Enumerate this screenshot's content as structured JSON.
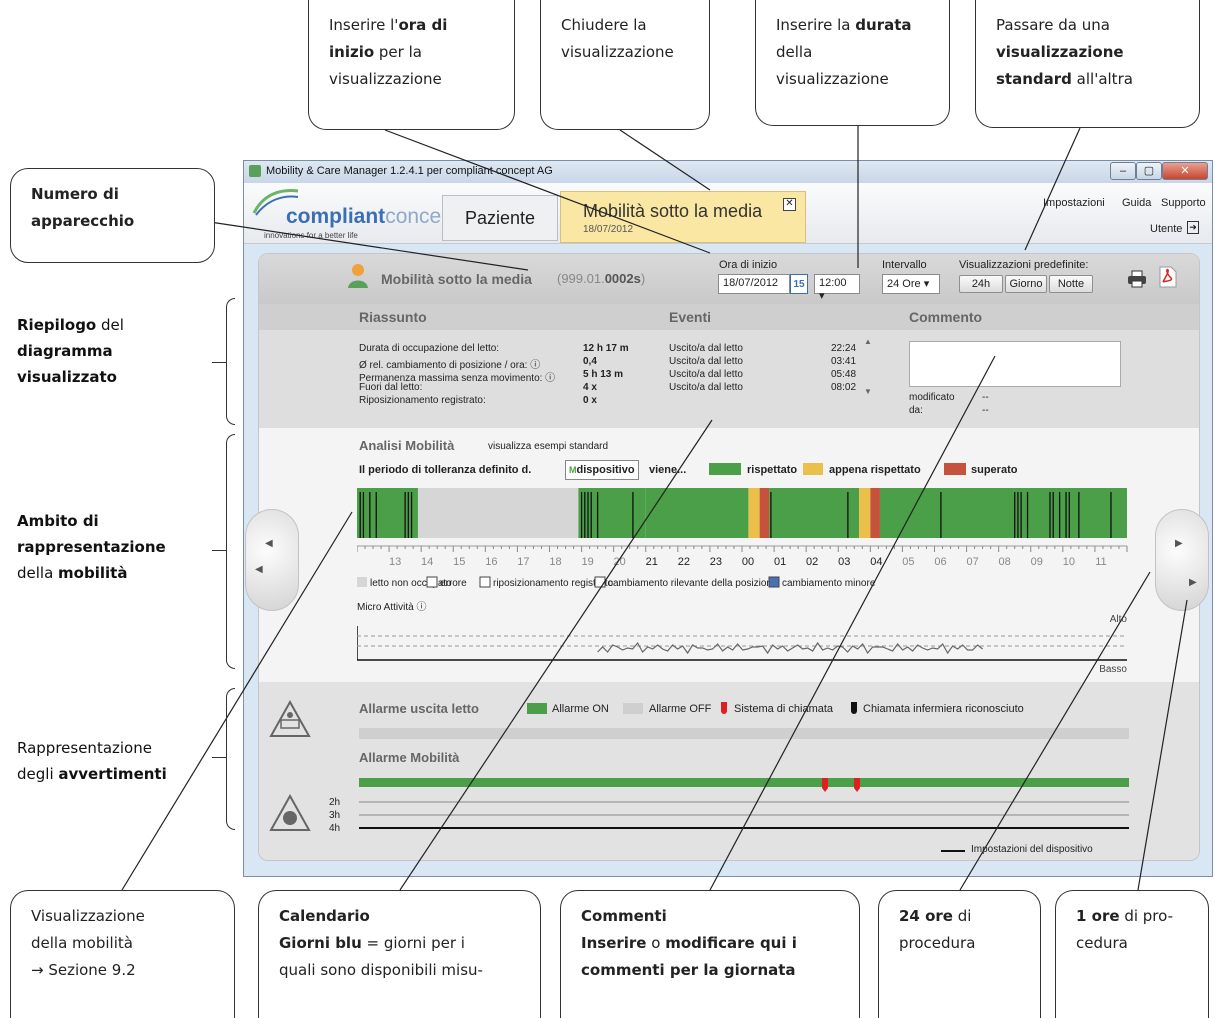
{
  "window": {
    "title": "Mobility & Care Manager 1.2.4.1 per compliant concept AG",
    "btn_min": "–",
    "btn_max": "▢",
    "btn_close": "✕"
  },
  "appbar": {
    "logo_bold": "compliant",
    "logo_light": "concept",
    "tagline": "innovations for a better life",
    "tab_patient": "Paziente",
    "tab_active_title": "Mobilità sotto la media",
    "tab_active_date": "18/07/2012",
    "tab_close": "✕",
    "links": [
      "Impostazioni",
      "Guida",
      "Supporto"
    ],
    "user": "Utente"
  },
  "header": {
    "title": "Mobilità sotto la media",
    "device_prefix": "(999.01.",
    "device_bold": "0002s",
    "device_suffix": ")",
    "start_label": "Ora di inizio",
    "date_value": "18/07/2012",
    "cal_day": "15",
    "time_value": "12:00",
    "interval_label": "Intervallo",
    "interval_value": "24 Ore",
    "predef_label": "Visualizzazioni predefinite:",
    "predef_buttons": [
      "24h",
      "Giorno",
      "Notte"
    ]
  },
  "summary": {
    "heading": "Riassunto",
    "rows": [
      {
        "label": "Durata di occupazione del letto:",
        "value": "12 h 17 m"
      },
      {
        "label": "Ø rel. cambiamento di posizione / ora: ⓘ",
        "value": "0,4"
      },
      {
        "label": "Permanenza massima senza movimento: ⓘ",
        "value": "5 h 13 m"
      },
      {
        "label": "Fuori dal letto:",
        "value": "4 x"
      },
      {
        "label": "Riposizionamento registrato:",
        "value": "0 x"
      }
    ]
  },
  "events": {
    "heading": "Eventi",
    "rows": [
      {
        "label": "Uscito/a dal letto",
        "time": "22:24"
      },
      {
        "label": "Uscito/a dal letto",
        "time": "03:41"
      },
      {
        "label": "Uscito/a dal letto",
        "time": "05:48"
      },
      {
        "label": "Uscito/a dal letto",
        "time": "08:02"
      }
    ]
  },
  "comment": {
    "heading": "Commento",
    "modified_label": "modificato",
    "modified_value": "--",
    "by_label": "da:",
    "by_value": "--"
  },
  "mobility": {
    "title": "Analisi Mobilità",
    "subtitle": "visualizza esempi standard",
    "tolerance_prefix": "Il periodo di tolleranza definito d.",
    "tolerance_button": "dispositivo",
    "tolerance_suffix": "viene...",
    "legend_rispettato": "rispettato",
    "legend_appena": "appena rispettato",
    "legend_superato": "superato",
    "hours": [
      "13",
      "14",
      "15",
      "16",
      "17",
      "18",
      "19",
      "20",
      "21",
      "22",
      "23",
      "00",
      "01",
      "02",
      "03",
      "04",
      "05",
      "06",
      "07",
      "08",
      "09",
      "10",
      "11"
    ],
    "legend2": [
      "letto non occupato",
      "errore",
      "riposizionamento registrato",
      "cambiamento rilevante della posizione",
      "cambiamento minore"
    ],
    "micro_title": "Micro Attività ⓘ",
    "micro_high": "Alto",
    "micro_low": "Basso"
  },
  "alarms": {
    "bed_exit_title": "Allarme uscita letto",
    "legend": [
      "Allarme ON",
      "Allarme OFF",
      "Sistema di chiamata",
      "Chiamata infermiera riconosciuto"
    ],
    "mobility_title": "Allarme Mobilità",
    "levels": [
      "2h",
      "3h",
      "4h"
    ],
    "device_settings": "Impostazioni del dispositivo"
  },
  "colors": {
    "green": "#4a9f48",
    "yellow": "#ebc04a",
    "red": "#c5523a",
    "grey": "#d6d6d6",
    "alarm_red": "#e02020"
  },
  "callouts_top": [
    {
      "parts": [
        [
          "Inserire l'",
          false
        ],
        [
          "ora di inizio",
          true
        ],
        [
          " per la visualizzazione",
          false
        ]
      ]
    },
    {
      "parts": [
        [
          "Chiudere la visualizzazione",
          false
        ]
      ]
    },
    {
      "parts": [
        [
          "Inserire la ",
          false
        ],
        [
          "durata",
          true
        ],
        [
          " della visualizzazione",
          false
        ]
      ]
    },
    {
      "parts": [
        [
          "Passare da una ",
          false
        ],
        [
          "visualizzazione standard",
          true
        ],
        [
          " all'altra",
          false
        ]
      ]
    }
  ],
  "callout_device": {
    "parts": [
      [
        "Numero di apparecchio",
        true
      ]
    ]
  },
  "left_labels": [
    {
      "parts": [
        [
          "Riepilogo",
          true
        ],
        [
          " del ",
          false
        ],
        [
          "diagramma visualizzato",
          true
        ]
      ]
    },
    {
      "parts": [
        [
          "Ambito di rappresentazione",
          true
        ],
        [
          " della ",
          false
        ],
        [
          "mobilità",
          true
        ]
      ]
    },
    {
      "parts": [
        [
          "Rappresentazione degli ",
          false
        ],
        [
          "avvertimenti",
          true
        ]
      ]
    }
  ],
  "callouts_bottom": [
    {
      "line1": "Visualizzazione",
      "line2": "della mobilità",
      "line3": "→ Sezione 9.2"
    },
    {
      "line1_b": "Calendario",
      "line2_b": "Giorni blu",
      "line2": " = giorni per i",
      "line3": "quali sono disponibili misu-"
    },
    {
      "line1_b": "Commenti",
      "line2_b": "Inserire",
      "line2": " o ",
      "line2_b2": "modificare qui i",
      "line3_b": "commenti per la giornata"
    },
    {
      "line1_b": "24 ore",
      "line1": " di",
      "line2": "procedura"
    },
    {
      "line1_b": "1 ore",
      "line1": " di pro-",
      "line2": "cedura"
    }
  ]
}
